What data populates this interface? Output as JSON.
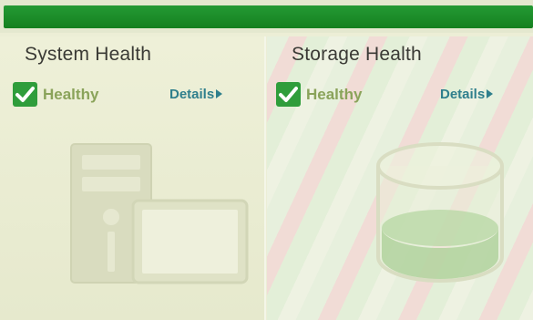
{
  "header": {
    "accent_color": "#1a8c28"
  },
  "panels": [
    {
      "title": "System Health",
      "status": "Healthy",
      "details_label": "Details",
      "status_icon": "check-icon",
      "illustration_icon": "server-computer-icon"
    },
    {
      "title": "Storage Health",
      "status": "Healthy",
      "details_label": "Details",
      "status_icon": "check-icon",
      "illustration_icon": "storage-disk-icon"
    }
  ],
  "colors": {
    "status_ok": "#2f9d3b",
    "link": "#2f7f8c"
  }
}
